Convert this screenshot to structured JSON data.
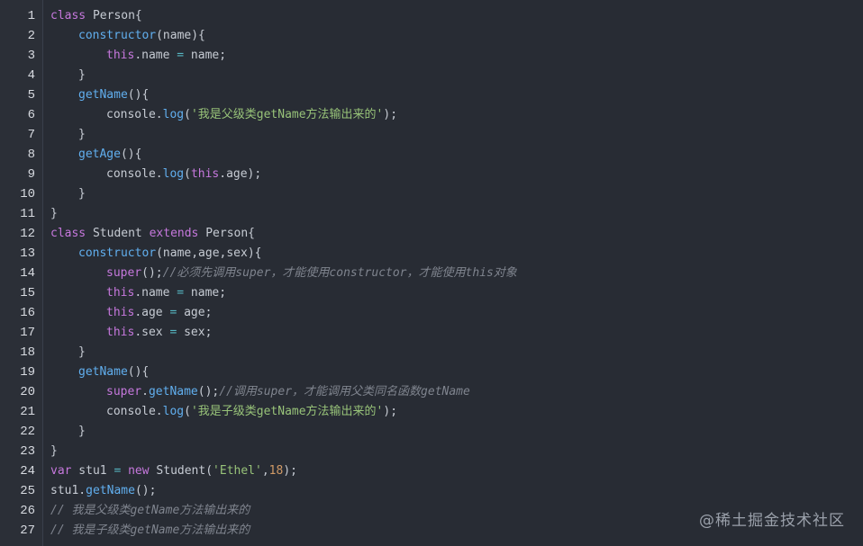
{
  "code_lines": [
    {
      "n": "1",
      "indent": 0,
      "tokens": [
        {
          "t": "class",
          "c": "kw"
        },
        {
          "t": " Person{",
          "c": "tx"
        }
      ]
    },
    {
      "n": "2",
      "indent": 1,
      "tokens": [
        {
          "t": "constructor",
          "c": "fn"
        },
        {
          "t": "(name){",
          "c": "tx"
        }
      ]
    },
    {
      "n": "3",
      "indent": 2,
      "tokens": [
        {
          "t": "this",
          "c": "kw"
        },
        {
          "t": ".name ",
          "c": "tx"
        },
        {
          "t": "=",
          "c": "op"
        },
        {
          "t": " name;",
          "c": "tx"
        }
      ]
    },
    {
      "n": "4",
      "indent": 1,
      "tokens": [
        {
          "t": "}",
          "c": "tx"
        }
      ]
    },
    {
      "n": "5",
      "indent": 1,
      "tokens": [
        {
          "t": "getName",
          "c": "fn"
        },
        {
          "t": "(){",
          "c": "tx"
        }
      ]
    },
    {
      "n": "6",
      "indent": 2,
      "tokens": [
        {
          "t": "console.",
          "c": "tx"
        },
        {
          "t": "log",
          "c": "fn"
        },
        {
          "t": "(",
          "c": "tx"
        },
        {
          "t": "'我是父级类getName方法输出来的'",
          "c": "str"
        },
        {
          "t": ");",
          "c": "tx"
        }
      ]
    },
    {
      "n": "7",
      "indent": 1,
      "tokens": [
        {
          "t": "}",
          "c": "tx"
        }
      ]
    },
    {
      "n": "8",
      "indent": 1,
      "tokens": [
        {
          "t": "getAge",
          "c": "fn"
        },
        {
          "t": "(){",
          "c": "tx"
        }
      ]
    },
    {
      "n": "9",
      "indent": 2,
      "tokens": [
        {
          "t": "console.",
          "c": "tx"
        },
        {
          "t": "log",
          "c": "fn"
        },
        {
          "t": "(",
          "c": "tx"
        },
        {
          "t": "this",
          "c": "kw"
        },
        {
          "t": ".age);",
          "c": "tx"
        }
      ]
    },
    {
      "n": "10",
      "indent": 1,
      "tokens": [
        {
          "t": "}",
          "c": "tx"
        }
      ]
    },
    {
      "n": "11",
      "indent": 0,
      "tokens": [
        {
          "t": "}",
          "c": "tx"
        }
      ]
    },
    {
      "n": "12",
      "indent": 0,
      "tokens": [
        {
          "t": "class",
          "c": "kw"
        },
        {
          "t": " Student ",
          "c": "tx"
        },
        {
          "t": "extends",
          "c": "kw"
        },
        {
          "t": " Person{",
          "c": "tx"
        }
      ]
    },
    {
      "n": "13",
      "indent": 1,
      "tokens": [
        {
          "t": "constructor",
          "c": "fn"
        },
        {
          "t": "(name,age,sex){",
          "c": "tx"
        }
      ]
    },
    {
      "n": "14",
      "indent": 2,
      "tokens": [
        {
          "t": "super",
          "c": "kw"
        },
        {
          "t": "();",
          "c": "tx"
        },
        {
          "t": "//必须先调用super，才能使用constructor，才能使用this对象",
          "c": "cm"
        }
      ]
    },
    {
      "n": "15",
      "indent": 2,
      "tokens": [
        {
          "t": "this",
          "c": "kw"
        },
        {
          "t": ".name ",
          "c": "tx"
        },
        {
          "t": "=",
          "c": "op"
        },
        {
          "t": " name;",
          "c": "tx"
        }
      ]
    },
    {
      "n": "16",
      "indent": 2,
      "tokens": [
        {
          "t": "this",
          "c": "kw"
        },
        {
          "t": ".age ",
          "c": "tx"
        },
        {
          "t": "=",
          "c": "op"
        },
        {
          "t": " age;",
          "c": "tx"
        }
      ]
    },
    {
      "n": "17",
      "indent": 2,
      "tokens": [
        {
          "t": "this",
          "c": "kw"
        },
        {
          "t": ".sex ",
          "c": "tx"
        },
        {
          "t": "=",
          "c": "op"
        },
        {
          "t": " sex;",
          "c": "tx"
        }
      ]
    },
    {
      "n": "18",
      "indent": 1,
      "tokens": [
        {
          "t": "}",
          "c": "tx"
        }
      ]
    },
    {
      "n": "19",
      "indent": 1,
      "tokens": [
        {
          "t": "getName",
          "c": "fn"
        },
        {
          "t": "(){",
          "c": "tx"
        }
      ]
    },
    {
      "n": "20",
      "indent": 2,
      "tokens": [
        {
          "t": "super",
          "c": "kw"
        },
        {
          "t": ".",
          "c": "tx"
        },
        {
          "t": "getName",
          "c": "fn"
        },
        {
          "t": "();",
          "c": "tx"
        },
        {
          "t": "//调用super，才能调用父类同名函数getName",
          "c": "cm"
        }
      ]
    },
    {
      "n": "21",
      "indent": 2,
      "tokens": [
        {
          "t": "console.",
          "c": "tx"
        },
        {
          "t": "log",
          "c": "fn"
        },
        {
          "t": "(",
          "c": "tx"
        },
        {
          "t": "'我是子级类getName方法输出来的'",
          "c": "str"
        },
        {
          "t": ");",
          "c": "tx"
        }
      ]
    },
    {
      "n": "22",
      "indent": 1,
      "tokens": [
        {
          "t": "}",
          "c": "tx"
        }
      ]
    },
    {
      "n": "23",
      "indent": 0,
      "tokens": [
        {
          "t": "}",
          "c": "tx"
        }
      ]
    },
    {
      "n": "24",
      "indent": 0,
      "tokens": [
        {
          "t": "var",
          "c": "kw"
        },
        {
          "t": " stu1 ",
          "c": "tx"
        },
        {
          "t": "=",
          "c": "op"
        },
        {
          "t": " ",
          "c": "tx"
        },
        {
          "t": "new",
          "c": "kw"
        },
        {
          "t": " Student(",
          "c": "tx"
        },
        {
          "t": "'Ethel'",
          "c": "str"
        },
        {
          "t": ",",
          "c": "tx"
        },
        {
          "t": "18",
          "c": "num"
        },
        {
          "t": ");",
          "c": "tx"
        }
      ]
    },
    {
      "n": "25",
      "indent": 0,
      "tokens": [
        {
          "t": "stu1.",
          "c": "tx"
        },
        {
          "t": "getName",
          "c": "fn"
        },
        {
          "t": "();",
          "c": "tx"
        }
      ]
    },
    {
      "n": "26",
      "indent": 0,
      "tokens": [
        {
          "t": "// 我是父级类getName方法输出来的",
          "c": "cm"
        }
      ]
    },
    {
      "n": "27",
      "indent": 0,
      "tokens": [
        {
          "t": "// 我是子级类getName方法输出来的",
          "c": "cm"
        }
      ]
    }
  ],
  "watermark": "@稀土掘金技术社区",
  "colors": {
    "background": "#282c34",
    "keyword": "#c678dd",
    "function": "#61afef",
    "string": "#98c379",
    "number": "#d19a66",
    "comment": "#7f848e",
    "text": "#c6cbd3"
  }
}
